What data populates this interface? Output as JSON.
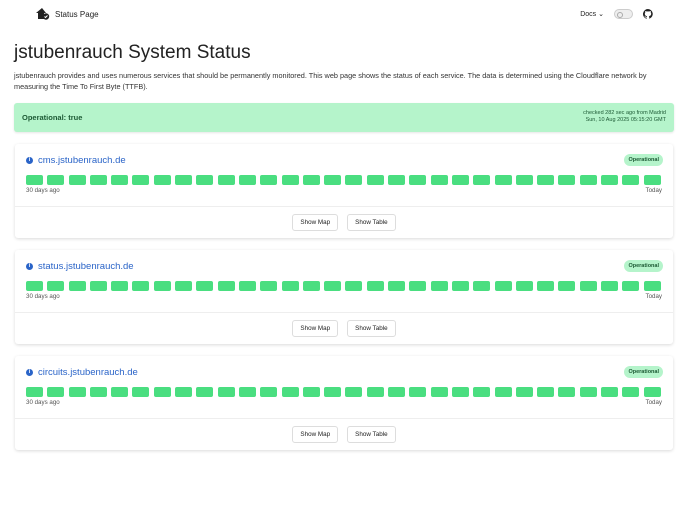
{
  "nav": {
    "brand": "Status Page",
    "docs": "Docs",
    "toggle_label": "0"
  },
  "title": "jstubenrauch System Status",
  "description": "jstubenrauch provides and uses numerous services that should be permanently monitored. This web page shows the status of each service. The data is determined using the Cloudflare network by measuring the Time To First Byte (TTFB).",
  "banner": {
    "status": "Operational: true",
    "checked": "checked 282 sec ago from Madrid",
    "date": "Sun, 10 Aug 2025 05:15:20 GMT",
    "color": "#b5f4cb"
  },
  "bar_color": "#4ade80",
  "services": [
    {
      "name": "cms.jstubenrauch.de",
      "status": "Operational",
      "days": 30,
      "start": "30 days ago",
      "end": "Today",
      "map": "Show Map",
      "table": "Show Table"
    },
    {
      "name": "status.jstubenrauch.de",
      "status": "Operational",
      "days": 30,
      "start": "30 days ago",
      "end": "Today",
      "map": "Show Map",
      "table": "Show Table"
    },
    {
      "name": "circuits.jstubenrauch.de",
      "status": "Operational",
      "days": 30,
      "start": "30 days ago",
      "end": "Today",
      "map": "Show Map",
      "table": "Show Table"
    }
  ]
}
